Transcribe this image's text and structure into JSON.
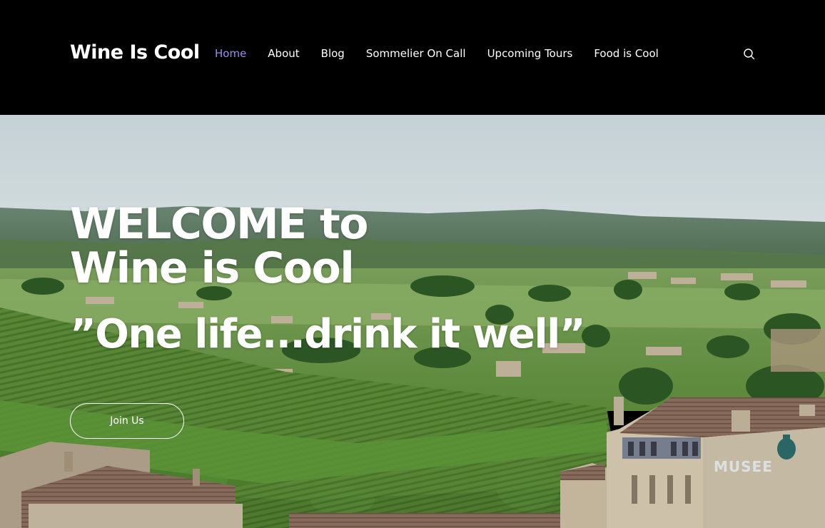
{
  "site": {
    "logo": "Wine Is Cool"
  },
  "nav": {
    "items": [
      {
        "label": "Home",
        "active": true
      },
      {
        "label": "About",
        "active": false
      },
      {
        "label": "Blog",
        "active": false
      },
      {
        "label": "Sommelier On Call",
        "active": false
      },
      {
        "label": "Upcoming Tours",
        "active": false
      },
      {
        "label": "Food is Cool",
        "active": false
      }
    ],
    "search_icon": "search-icon"
  },
  "hero": {
    "heading_line1": "WELCOME to",
    "heading_line2": "Wine is Cool",
    "tagline": "”One life...drink it well”",
    "cta_label": "Join Us",
    "sign_text": "MUSEE"
  },
  "colors": {
    "header_bg": "#000000",
    "nav_active": "#9b8cf0",
    "text": "#ffffff"
  }
}
